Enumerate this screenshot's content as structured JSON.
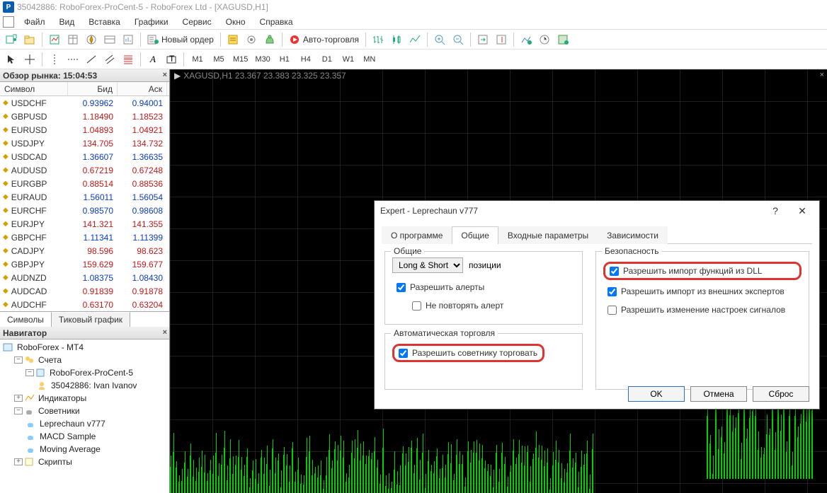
{
  "title": "35042886: RoboForex-ProCent-5 - RoboForex Ltd - [XAGUSD,H1]",
  "menu": [
    "Файл",
    "Вид",
    "Вставка",
    "Графики",
    "Сервис",
    "Окно",
    "Справка"
  ],
  "toolbar1": {
    "new_order": "Новый ордер",
    "autotrade": "Авто-торговля"
  },
  "timeframes": [
    "M1",
    "M5",
    "M15",
    "M30",
    "H1",
    "H4",
    "D1",
    "W1",
    "MN"
  ],
  "market_watch": {
    "title": "Обзор рынка: 15:04:53",
    "cols": {
      "symbol": "Символ",
      "bid": "Бид",
      "ask": "Аск"
    },
    "rows": [
      {
        "s": "USDCHF",
        "b": "0.93962",
        "a": "0.94001",
        "d": "up"
      },
      {
        "s": "GBPUSD",
        "b": "1.18490",
        "a": "1.18523",
        "d": "dn"
      },
      {
        "s": "EURUSD",
        "b": "1.04893",
        "a": "1.04921",
        "d": "dn"
      },
      {
        "s": "USDJPY",
        "b": "134.705",
        "a": "134.732",
        "d": "dn"
      },
      {
        "s": "USDCAD",
        "b": "1.36607",
        "a": "1.36635",
        "d": "up"
      },
      {
        "s": "AUDUSD",
        "b": "0.67219",
        "a": "0.67248",
        "d": "dn"
      },
      {
        "s": "EURGBP",
        "b": "0.88514",
        "a": "0.88536",
        "d": "dn"
      },
      {
        "s": "EURAUD",
        "b": "1.56011",
        "a": "1.56054",
        "d": "up"
      },
      {
        "s": "EURCHF",
        "b": "0.98570",
        "a": "0.98608",
        "d": "up"
      },
      {
        "s": "EURJPY",
        "b": "141.321",
        "a": "141.355",
        "d": "dn"
      },
      {
        "s": "GBPCHF",
        "b": "1.11341",
        "a": "1.11399",
        "d": "up"
      },
      {
        "s": "CADJPY",
        "b": "98.596",
        "a": "98.623",
        "d": "dn"
      },
      {
        "s": "GBPJPY",
        "b": "159.629",
        "a": "159.677",
        "d": "dn"
      },
      {
        "s": "AUDNZD",
        "b": "1.08375",
        "a": "1.08430",
        "d": "up"
      },
      {
        "s": "AUDCAD",
        "b": "0.91839",
        "a": "0.91878",
        "d": "dn"
      },
      {
        "s": "AUDCHF",
        "b": "0.63170",
        "a": "0.63204",
        "d": "dn"
      }
    ],
    "tabs": {
      "symbols": "Символы",
      "tick": "Тиковый график"
    }
  },
  "navigator": {
    "title": "Навигатор",
    "root": "RoboForex - MT4",
    "accounts": "Счета",
    "server": "RoboForex-ProCent-5",
    "account": "35042886: Ivan Ivanov",
    "indicators": "Индикаторы",
    "experts": "Советники",
    "ea1": "Leprechaun v777",
    "ea2": "MACD Sample",
    "ea3": "Moving Average",
    "scripts": "Скрипты"
  },
  "chart": {
    "label": "XAGUSD,H1  23.367 23.383 23.325 23.357"
  },
  "dialog": {
    "title": "Expert - Leprechaun v777",
    "tabs": {
      "about": "О программе",
      "common": "Общие",
      "inputs": "Входные параметры",
      "deps": "Зависимости"
    },
    "common_group": "Общие",
    "positions_option": "Long & Short",
    "positions_label": "позиции",
    "alerts": "Разрешить алерты",
    "no_repeat": "Не повторять алерт",
    "autotrade_group": "Автоматическая торговля",
    "allow_trade": "Разрешить советнику торговать",
    "security_group": "Безопасность",
    "allow_dll": "Разрешить импорт функций из DLL",
    "allow_ext": "Разрешить импорт из внешних экспертов",
    "allow_sig": "Разрешить изменение настроек сигналов",
    "ok": "OK",
    "cancel": "Отмена",
    "reset": "Сброс"
  }
}
